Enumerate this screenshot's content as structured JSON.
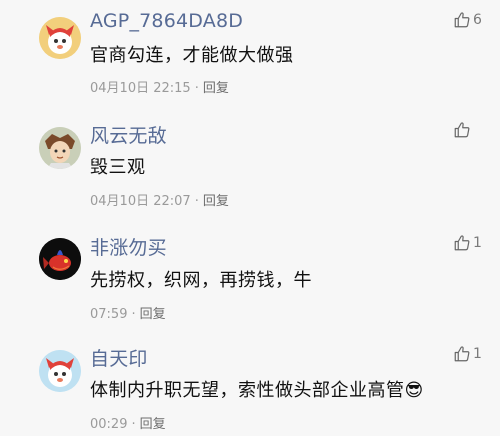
{
  "comments": [
    {
      "username": "AGP_7864DA8D",
      "text": "官商勾连，才能做大做强",
      "time": "04月10日 22:15",
      "reply_label": "回复",
      "likes": "6",
      "avatar_icon": "cartoon-devil-avatar-icon"
    },
    {
      "username": "风云无敌",
      "text": "毁三观",
      "time": "04月10日 22:07",
      "reply_label": "回复",
      "likes": "",
      "avatar_icon": "anime-character-avatar-icon"
    },
    {
      "username": "非涨勿买",
      "text": "先捞权，织网，再捞钱，牛",
      "time": "07:59",
      "reply_label": "回复",
      "likes": "1",
      "avatar_icon": "red-fish-avatar-icon"
    },
    {
      "username": "自天印",
      "text": "体制内升职无望，索性做头部企业高管",
      "emoji": "😎",
      "time": "00:29",
      "reply_label": "回复",
      "likes": "1",
      "avatar_icon": "cartoon-devil-avatar-icon"
    }
  ],
  "colors": {
    "background": "#f7f7f7",
    "username": "#576b95",
    "text": "#111111",
    "meta": "#9a9a9a"
  }
}
